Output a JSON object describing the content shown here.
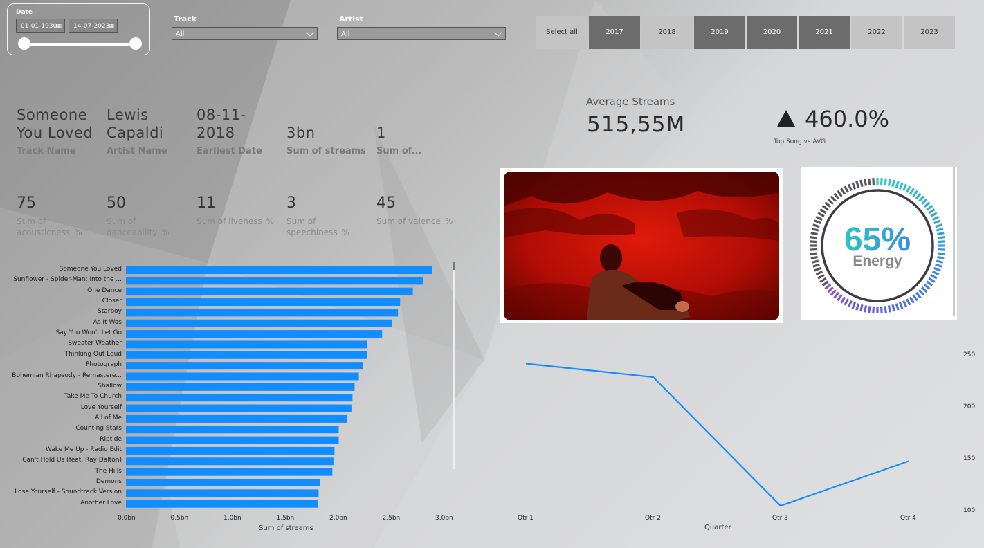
{
  "date_slicer": {
    "title": "Date",
    "start": "01-01-1930",
    "end": "14-07-2023",
    "calendar_icon": "calendar-icon"
  },
  "track_slicer": {
    "title": "Track",
    "value": "All"
  },
  "artist_slicer": {
    "title": "Artist",
    "value": "All"
  },
  "year_buttons": [
    {
      "label": "Select all",
      "selected": false
    },
    {
      "label": "2017",
      "selected": true
    },
    {
      "label": "2018",
      "selected": false
    },
    {
      "label": "2019",
      "selected": true
    },
    {
      "label": "2020",
      "selected": true
    },
    {
      "label": "2021",
      "selected": true
    },
    {
      "label": "2022",
      "selected": false
    },
    {
      "label": "2023",
      "selected": false
    }
  ],
  "cards": {
    "track_name": {
      "value": "Someone\nYou Loved",
      "label": "Track Name"
    },
    "artist_name": {
      "value": "Lewis\nCapaldi",
      "label": "Artist Name"
    },
    "earliest_date": {
      "value": "08-11-\n2018",
      "label": "Earliest Date"
    },
    "sum_streams": {
      "value": "3bn",
      "label": "Sum of streams"
    },
    "sum_other": {
      "value": "1",
      "label": "Sum of..."
    }
  },
  "kpis": [
    {
      "value": "75",
      "label": "Sum of\nacousticness_%"
    },
    {
      "value": "50",
      "label": "Sum of\ndanceability_%"
    },
    {
      "value": "11",
      "label": "Sum of liveness_%"
    },
    {
      "value": "3",
      "label": "Sum of\nspeechiness_%"
    },
    {
      "value": "45",
      "label": "Sum of valence_%"
    }
  ],
  "average_streams": {
    "label": "Average Streams",
    "value": "515,55M"
  },
  "top_song_vs_avg": {
    "value": "460.0%",
    "label": "Top Song vs AVG",
    "icon": "triangle-up-icon"
  },
  "energy_gauge": {
    "percent_text": "65%",
    "label": "Energy",
    "percent": 65
  },
  "colors": {
    "bar": "#118dff",
    "line": "#118dff",
    "selected_year": "#6c6c6c",
    "unselected_year": "#c4c4c4"
  },
  "chart_data": [
    {
      "type": "bar",
      "orientation": "horizontal",
      "categories": [
        "Someone You Loved",
        "Sunflower - Spider-Man: Into the ...",
        "One Dance",
        "Closer",
        "Starboy",
        "As It Was",
        "Say You Won't Let Go",
        "Sweater Weather",
        "Thinking Out Loud",
        "Photograph",
        "Bohemian Rhapsody - Remastere...",
        "Shallow",
        "Take Me To Church",
        "Love Yourself",
        "All of Me",
        "Counting Stars",
        "Riptide",
        "Wake Me Up - Radio Edit",
        "Can't Hold Us (feat. Ray Dalton)",
        "The Hills",
        "Demons",
        "Lose Yourself - Soundtrack Version",
        "Another Love"
      ],
      "values": [
        2.89,
        2.81,
        2.71,
        2.59,
        2.57,
        2.51,
        2.42,
        2.28,
        2.28,
        2.24,
        2.2,
        2.16,
        2.14,
        2.13,
        2.09,
        2.01,
        2.01,
        1.97,
        1.96,
        1.95,
        1.83,
        1.82,
        1.81
      ],
      "xlabel": "Sum of streams",
      "xticks": [
        "0,0bn",
        "0,5bn",
        "1,0bn",
        "1,5bn",
        "2,0bn",
        "2,5bn",
        "3,0bn"
      ],
      "xlim": [
        0,
        3
      ]
    },
    {
      "type": "line",
      "categories": [
        "Qtr 1",
        "Qtr 2",
        "Qtr 3",
        "Qtr 4"
      ],
      "values": [
        243,
        230,
        106,
        149
      ],
      "xlabel": "Quarter",
      "yticks": [
        "250",
        "200",
        "150",
        "100"
      ],
      "ylim": [
        100,
        250
      ]
    }
  ]
}
